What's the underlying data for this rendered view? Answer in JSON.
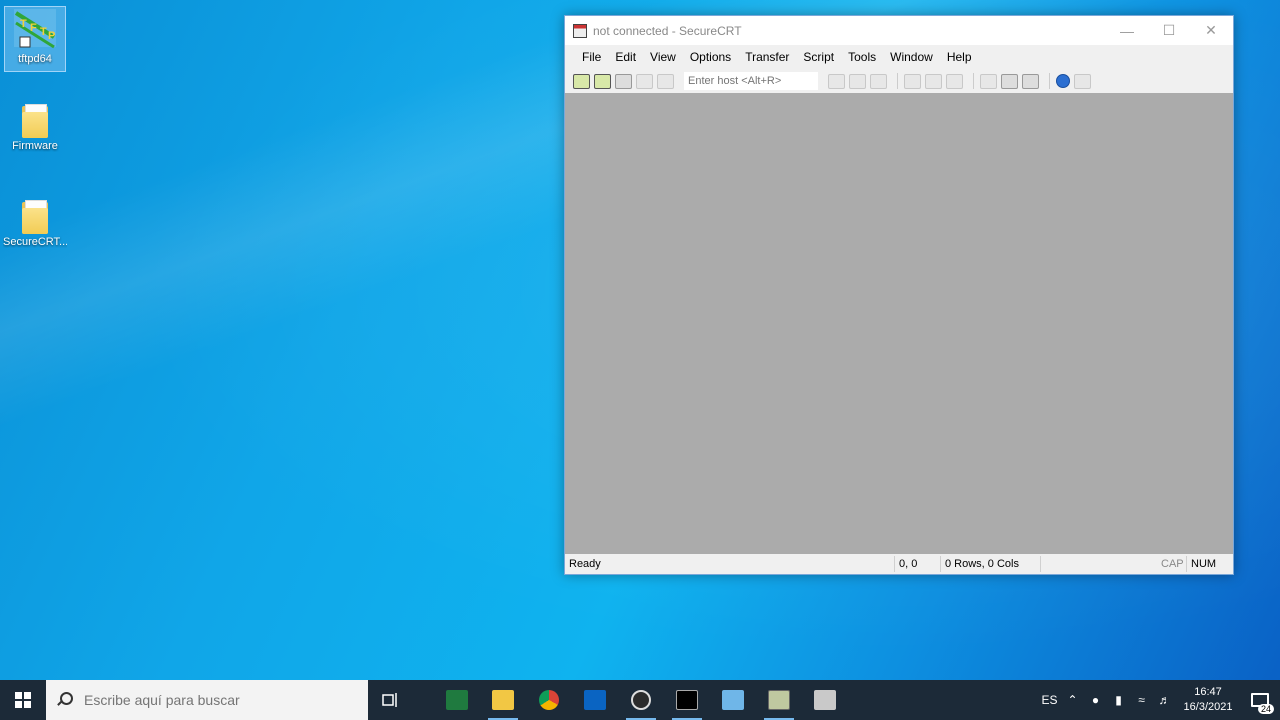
{
  "desktop": {
    "icons": [
      {
        "label": "tftpd64"
      },
      {
        "label": "Firmware"
      },
      {
        "label": "SecureCRT..."
      }
    ]
  },
  "window": {
    "title": "not connected - SecureCRT",
    "menu": [
      "File",
      "Edit",
      "View",
      "Options",
      "Transfer",
      "Script",
      "Tools",
      "Window",
      "Help"
    ],
    "host_placeholder": "Enter host <Alt+R>",
    "status": {
      "ready": "Ready",
      "position": "0, 0",
      "size": "0 Rows, 0 Cols",
      "cap": "CAP",
      "num": "NUM"
    }
  },
  "taskbar": {
    "search_placeholder": "Escribe aquí para buscar",
    "language": "ES",
    "time": "16:47",
    "date": "16/3/2021",
    "notifications": "24",
    "apps": [
      "task-view",
      "excel",
      "file-explorer",
      "chrome",
      "outlook",
      "obs",
      "terminal",
      "remote-desktop",
      "securecrt",
      "network-tool"
    ]
  },
  "colors": {
    "accent": "#0fb3ef",
    "taskbar": "#1c2a38",
    "terminal_bg": "#ababab"
  }
}
